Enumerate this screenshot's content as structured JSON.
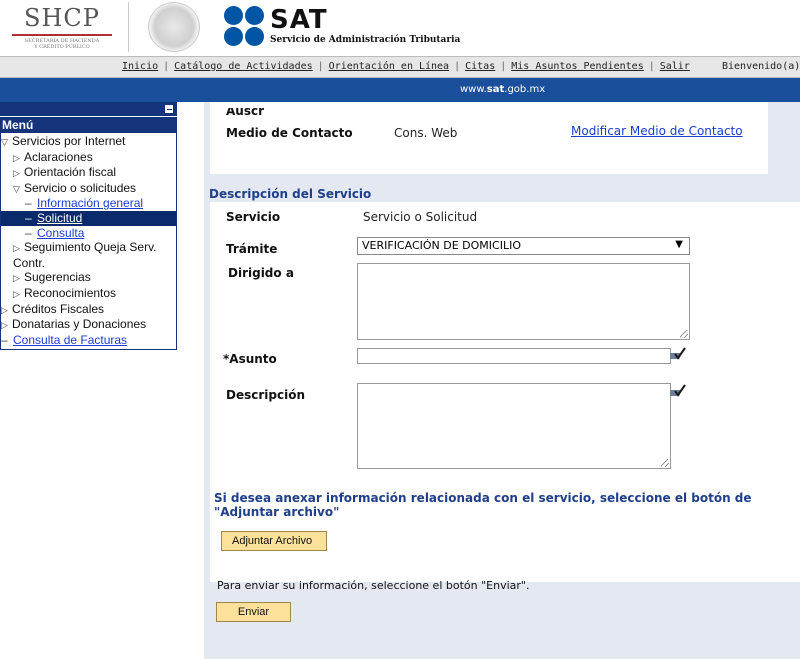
{
  "header": {
    "shcp_title": "SHCP",
    "shcp_subtitle_line1": "SECRETARÍA DE HACIENDA",
    "shcp_subtitle_line2": "Y CRÉDITO PÚBLICO",
    "sat_title": "SAT",
    "sat_subtitle": "Servicio de Administración Tributaria",
    "brand_color": "#0055a5"
  },
  "topnav": {
    "items": [
      "Inicio",
      "Catálogo de Actividades",
      "Orientación en Línea",
      "Citas",
      "Mis Asuntos Pendientes",
      "Salir"
    ],
    "welcome": "Bienvenido(a) M"
  },
  "bluebar": {
    "url_prefix": "www.",
    "url_bold": "sat",
    "url_suffix": ".gob.mx"
  },
  "sidebar": {
    "heading": "Menú",
    "items": {
      "servicios_internet": "Servicios por Internet",
      "aclaraciones": "Aclaraciones",
      "orientacion_fiscal": "Orientación fiscal",
      "servicio_solicitudes": "Servicio o solicitudes",
      "informacion_general": "Información general",
      "solicitud": "Solicitud",
      "consulta": "Consulta",
      "seguimiento_queja": "Seguimiento Queja Serv. Contr.",
      "sugerencias": "Sugerencias",
      "reconocimientos": "Reconocimientos",
      "creditos_fiscales": "Créditos Fiscales",
      "donatarias": "Donatarias y Donaciones",
      "consulta_facturas": "Consulta de Facturas"
    }
  },
  "contact": {
    "cut_label": "Auscr",
    "medio_label": "Medio de Contacto",
    "medio_value": "Cons. Web",
    "modificar_link": "Modificar Medio de Contacto"
  },
  "service": {
    "section_title": "Descripción del Servicio",
    "servicio_label": "Servicio",
    "servicio_value": "Servicio o Solicitud",
    "tramite_label": "Trámite",
    "tramite_selected": "VERIFICACIÓN DE DOMICILIO",
    "dirigido_label": "Dirigido a",
    "dirigido_value": "",
    "asunto_label": "*Asunto",
    "asunto_value": "",
    "descripcion_label": "Descripción",
    "descripcion_value": ""
  },
  "attach": {
    "title": "Si desea anexar información relacionada con el servicio, seleccione el botón de \"Adjuntar archivo\"",
    "button": "Adjuntar Archivo"
  },
  "send": {
    "note": "Para enviar su información, seleccione el botón \"Enviar\".",
    "button": "Enviar"
  }
}
